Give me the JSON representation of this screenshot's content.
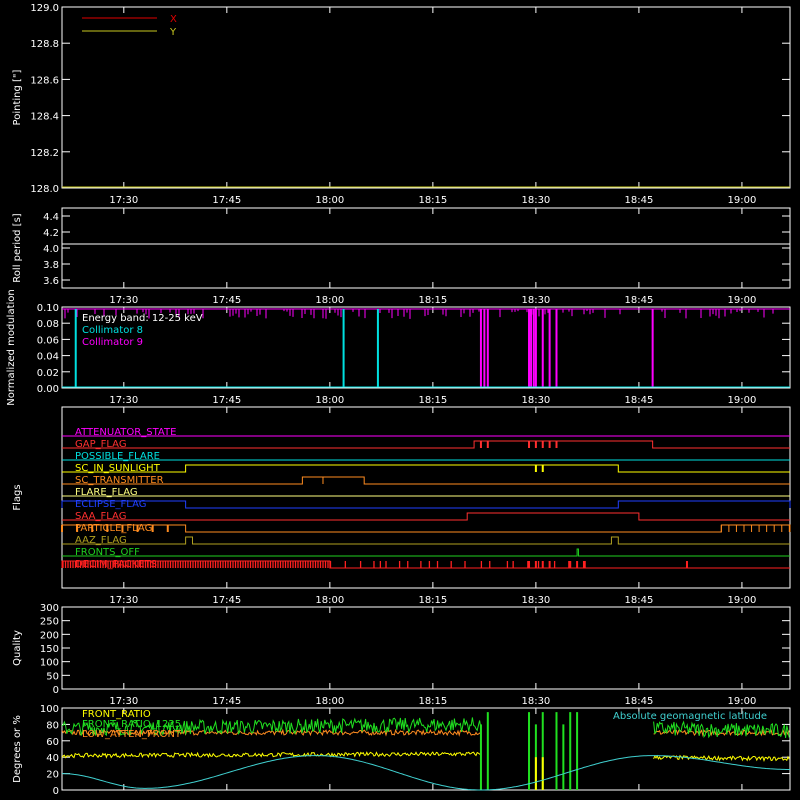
{
  "chart_data": [
    {
      "type": "line",
      "ylabel": "Pointing [\"]",
      "ylim": [
        128.0,
        129.0
      ],
      "yticks": [
        "128.0",
        "128.2",
        "128.4",
        "128.6",
        "128.8",
        "129.0"
      ],
      "xticks": [
        "17:30",
        "17:45",
        "18:00",
        "18:15",
        "18:30",
        "18:45",
        "19:00"
      ],
      "xlim_minutes_of_day": [
        1041,
        1147
      ],
      "series": [
        {
          "name": "X",
          "color": "#e00000",
          "x": [
            "17:21",
            "19:07"
          ],
          "values": [
            128.0,
            128.0
          ]
        },
        {
          "name": "Y",
          "color": "#c8c820",
          "x": [
            "17:21",
            "19:07"
          ],
          "values": [
            128.0,
            128.0
          ]
        }
      ]
    },
    {
      "type": "line",
      "ylabel": "Roll period [s]",
      "ylim": [
        3.5,
        4.5
      ],
      "yticks": [
        "3.6",
        "3.8",
        "4.0",
        "4.2",
        "4.4"
      ],
      "xticks": [
        "17:30",
        "17:45",
        "18:00",
        "18:15",
        "18:30",
        "18:45",
        "19:00"
      ],
      "series": [
        {
          "color": "#ffffff",
          "x": [
            "17:21",
            "19:07"
          ],
          "values": [
            4.05,
            4.05
          ]
        }
      ]
    },
    {
      "type": "line",
      "ylabel": "Normalized modulation",
      "ylim": [
        0,
        0.1
      ],
      "yticks": [
        "0.00",
        "0.02",
        "0.04",
        "0.06",
        "0.08",
        "0.10"
      ],
      "xticks": [
        "17:30",
        "17:45",
        "18:00",
        "18:15",
        "18:30",
        "18:45",
        "19:00"
      ],
      "annotations": [
        "Energy band: 12-25 keV"
      ],
      "series": [
        {
          "name": "Collimator 8",
          "color": "#00e0e0",
          "drops_at": [
            "17:23",
            "18:02",
            "18:07"
          ]
        },
        {
          "name": "Collimator 9",
          "color": "#ff00ff",
          "drops_at": [
            "18:22",
            "18:22.5",
            "18:23",
            "18:29",
            "18:29.3",
            "18:29.7",
            "18:30",
            "18:31",
            "18:32",
            "18:33",
            "18:47"
          ]
        }
      ]
    },
    {
      "type": "line",
      "ylabel": "Flags",
      "xticks": [
        "17:30",
        "17:45",
        "18:00",
        "18:15",
        "18:30",
        "18:45",
        "19:00"
      ],
      "series": [
        {
          "name": "ATTENUATOR_STATE",
          "color": "#ff00ff",
          "segments": []
        },
        {
          "name": "GAP_FLAG",
          "color": "#ff3030",
          "segments": [
            [
              "18:21",
              "18:47"
            ]
          ]
        },
        {
          "name": "POSSIBLE_FLARE",
          "color": "#00e0e0",
          "segments": []
        },
        {
          "name": "SC_IN_SUNLIGHT",
          "color": "#ffff00",
          "segments": [
            [
              "17:39",
              "18:42"
            ]
          ]
        },
        {
          "name": "SC_TRANSMITTER",
          "color": "#ff8c20",
          "segments": [
            [
              "17:56",
              "17:59"
            ],
            [
              "17:59",
              "18:05"
            ]
          ]
        },
        {
          "name": "FLARE_FLAG",
          "color": "#ffff80",
          "segments": []
        },
        {
          "name": "ECLIPSE_FLAG",
          "color": "#2040ff",
          "segments": [
            [
              "17:21",
              "17:39"
            ],
            [
              "18:42",
              "19:07"
            ]
          ]
        },
        {
          "name": "SAA_FLAG",
          "color": "#ff3030",
          "segments": [
            [
              "18:20",
              "18:45"
            ]
          ]
        },
        {
          "name": "PARTICLE_FLAG",
          "color": "#ff8c20",
          "segments": [
            [
              "17:21",
              "17:39"
            ],
            [
              "18:57",
              "19:07"
            ]
          ]
        },
        {
          "name": "AAZ_FLAG",
          "color": "#b0a020",
          "segments": [
            [
              "17:39",
              "17:40"
            ],
            [
              "18:41",
              "18:42"
            ]
          ]
        },
        {
          "name": "FRONTS_OFF",
          "color": "#20d020",
          "segments": [
            [
              "18:36",
              "18:36.2"
            ]
          ]
        },
        {
          "name": "DECIM_PACKETS",
          "color": "#ff2020",
          "segments": [
            [
              "17:21",
              "18:00"
            ]
          ]
        }
      ]
    },
    {
      "type": "line",
      "ylabel": "Quality",
      "ylim": [
        0,
        300
      ],
      "yticks": [
        "0",
        "50",
        "100",
        "150",
        "200",
        "250",
        "300"
      ],
      "xticks": [
        "17:30",
        "17:45",
        "18:00",
        "18:15",
        "18:30",
        "18:45",
        "19:00"
      ],
      "series": []
    },
    {
      "type": "line",
      "ylabel": "Degrees or %",
      "ylim": [
        0,
        100
      ],
      "yticks": [
        "0",
        "20",
        "40",
        "60",
        "80",
        "100"
      ],
      "series": [
        {
          "name": "FRONT_RATIO",
          "color": "#ffff00",
          "x": [
            "17:21",
            "18:22",
            "18:45",
            "19:07"
          ],
          "values": [
            42,
            44,
            40,
            38
          ]
        },
        {
          "name": "FRONT_RATIO_1225",
          "color": "#20e020",
          "x": [
            "17:21",
            "18:22",
            "18:45",
            "19:07"
          ],
          "values": [
            75,
            80,
            75,
            72
          ]
        },
        {
          "name": "LOW_ATTEN_FRONT",
          "color": "#ff8c20",
          "x": [
            "17:21",
            "19:07"
          ],
          "values": [
            70,
            70
          ]
        },
        {
          "name": "Absolute geomagnetic latitude",
          "color": "#40d0d0",
          "x": [
            "17:21",
            "17:33",
            "17:58",
            "18:22",
            "18:47",
            "19:07"
          ],
          "values": [
            20,
            2,
            42,
            0,
            42,
            25
          ]
        }
      ]
    }
  ]
}
